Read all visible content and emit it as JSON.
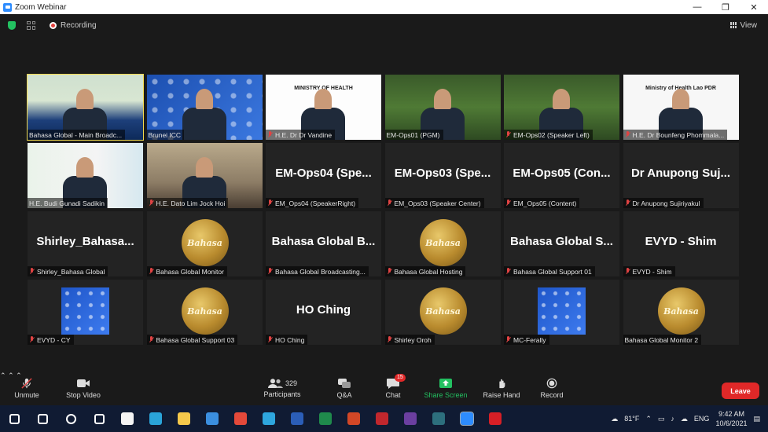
{
  "window": {
    "title": "Zoom Webinar",
    "controls": [
      "—",
      "❐",
      "✕"
    ]
  },
  "topbar": {
    "recording_label": "Recording",
    "view_label": "View"
  },
  "tiles": [
    {
      "name": "Bahasa Global - Main Broadc...",
      "muted": false,
      "kind": "video"
    },
    {
      "name": "Brunei ICC",
      "muted": false,
      "kind": "video"
    },
    {
      "name": "H.E. Dr Dr Vandine",
      "muted": true,
      "kind": "video",
      "overlay": "MINISTRY OF HEALTH"
    },
    {
      "name": "EM-Ops01 (PGM)",
      "muted": false,
      "kind": "video"
    },
    {
      "name": "EM-Ops02 (Speaker Left)",
      "muted": true,
      "kind": "video"
    },
    {
      "name": "H.E. Dr Bounfeng Phommala...",
      "muted": true,
      "kind": "video",
      "overlay": "Ministry of Health Lao PDR"
    },
    {
      "name": "H.E. Budi Gunadi Sadikin",
      "muted": false,
      "kind": "video"
    },
    {
      "name": "H.E. Dato Lim Jock Hoi",
      "muted": true,
      "kind": "video"
    },
    {
      "name": "EM_Ops04 (SpeakerRight)",
      "muted": true,
      "kind": "text",
      "big": "EM-Ops04 (Spe..."
    },
    {
      "name": "EM_Ops03 (Speaker Center)",
      "muted": true,
      "kind": "text",
      "big": "EM-Ops03 (Spe..."
    },
    {
      "name": "EM_Ops05 (Content)",
      "muted": true,
      "kind": "text",
      "big": "EM-Ops05 (Con..."
    },
    {
      "name": "Dr Anupong Sujiriyakul",
      "muted": true,
      "kind": "text",
      "big": "Dr Anupong Suj..."
    },
    {
      "name": "Shirley_Bahasa Global",
      "muted": true,
      "kind": "text",
      "big": "Shirley_Bahasa..."
    },
    {
      "name": "Bahasa Global Monitor",
      "muted": true,
      "kind": "logo",
      "logo": "Bahasa"
    },
    {
      "name": "Bahasa Global Broadcasting...",
      "muted": true,
      "kind": "text",
      "big": "Bahasa Global B..."
    },
    {
      "name": "Bahasa Global Hosting",
      "muted": true,
      "kind": "logo",
      "logo": "Bahasa"
    },
    {
      "name": "Bahasa Global Support 01",
      "muted": true,
      "kind": "text",
      "big": "Bahasa Global S..."
    },
    {
      "name": "EVYD - Shim",
      "muted": true,
      "kind": "text",
      "big": "EVYD - Shim"
    },
    {
      "name": "EVYD - CY",
      "muted": true,
      "kind": "dph"
    },
    {
      "name": "Bahasa Global Support 03",
      "muted": true,
      "kind": "logo",
      "logo": "Bahasa"
    },
    {
      "name": "HO Ching",
      "muted": true,
      "kind": "text",
      "big": "HO Ching"
    },
    {
      "name": "Shirley Oroh",
      "muted": true,
      "kind": "logo",
      "logo": "Bahasa"
    },
    {
      "name": "MC-Ferally",
      "muted": true,
      "kind": "dph"
    },
    {
      "name": "Bahasa Global Monitor 2",
      "muted": false,
      "kind": "logo",
      "logo": "Bahasa"
    }
  ],
  "toolbar": {
    "unmute": "Unmute",
    "stop_video": "Stop Video",
    "participants": "Participants",
    "participants_count": "329",
    "qa": "Q&A",
    "chat": "Chat",
    "chat_badge": "15",
    "share_screen": "Share Screen",
    "raise_hand": "Raise Hand",
    "record": "Record",
    "leave": "Leave"
  },
  "taskbar": {
    "weather": "81°F",
    "language": "ENG",
    "time": "9:42 AM",
    "date": "10/6/2021",
    "apps": [
      {
        "icon": "windows-start-icon",
        "color": "#ffffff"
      },
      {
        "icon": "search-icon",
        "color": "#ffffff"
      },
      {
        "icon": "cortana-icon",
        "color": "#ffffff"
      },
      {
        "icon": "task-view-icon",
        "color": "#ffffff"
      },
      {
        "icon": "store-icon",
        "color": "#f4f4f4"
      },
      {
        "icon": "edge-icon",
        "color": "#2aa4d9"
      },
      {
        "icon": "file-explorer-icon",
        "color": "#f5c84b"
      },
      {
        "icon": "mail-icon",
        "color": "#3b8fe0"
      },
      {
        "icon": "chrome-icon",
        "color": "#e4493a"
      },
      {
        "icon": "telegram-icon",
        "color": "#2ea6de"
      },
      {
        "icon": "word-icon",
        "color": "#2b5eb8"
      },
      {
        "icon": "excel-icon",
        "color": "#1f8a4c"
      },
      {
        "icon": "powerpoint-icon",
        "color": "#d24726"
      },
      {
        "icon": "app-red-icon",
        "color": "#c1272d"
      },
      {
        "icon": "app-book-icon",
        "color": "#6b3fa0"
      },
      {
        "icon": "app-teal-icon",
        "color": "#2d6f7d"
      },
      {
        "icon": "zoom-icon",
        "color": "#2d8cff"
      },
      {
        "icon": "acrobat-icon",
        "color": "#d71f26"
      }
    ]
  },
  "colors": {
    "active_speaker": "#f1d94f",
    "leave": "#e02828",
    "share": "#23c161",
    "muted": "#e04343"
  }
}
